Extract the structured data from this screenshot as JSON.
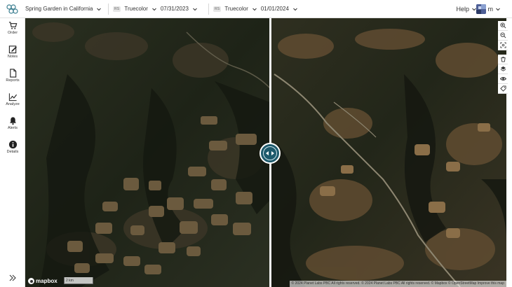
{
  "header": {
    "project_name": "Spring Garden in California",
    "layer_left": {
      "tag": "RS",
      "name": "Truecolor",
      "date": "07/31/2023"
    },
    "layer_right": {
      "tag": "RS",
      "name": "Truecolor",
      "date": "01/01/2024"
    },
    "help_label": "Help",
    "user_initial": "m"
  },
  "sidebar": {
    "items": [
      {
        "label": "Order",
        "icon": "cart-icon"
      },
      {
        "label": "Notes",
        "icon": "note-edit-icon"
      },
      {
        "label": "Reports",
        "icon": "document-icon"
      },
      {
        "label": "Analyze",
        "icon": "chart-line-icon"
      },
      {
        "label": "Alerts",
        "icon": "bell-icon"
      },
      {
        "label": "Details",
        "icon": "info-icon"
      }
    ],
    "collapse_icon": "double-chevron-right-icon"
  },
  "map": {
    "mapbox_label": "mapbox",
    "scale_label": "2 km",
    "attribution": "© 2024 Planet Labs PBC All rights reserved.  © 2024 Planet Labs PBC All rights reserved.  © Mapbox © OpenStreetMap  Improve this map"
  },
  "tools": [
    "zoom-in-icon",
    "zoom-out-icon",
    "fit-screen-icon",
    "bucket-icon",
    "layers-icon",
    "eye-icon",
    "tag-icon"
  ],
  "colors": {
    "accent": "#1e5a6c",
    "sidebar_icon": "#222222"
  }
}
